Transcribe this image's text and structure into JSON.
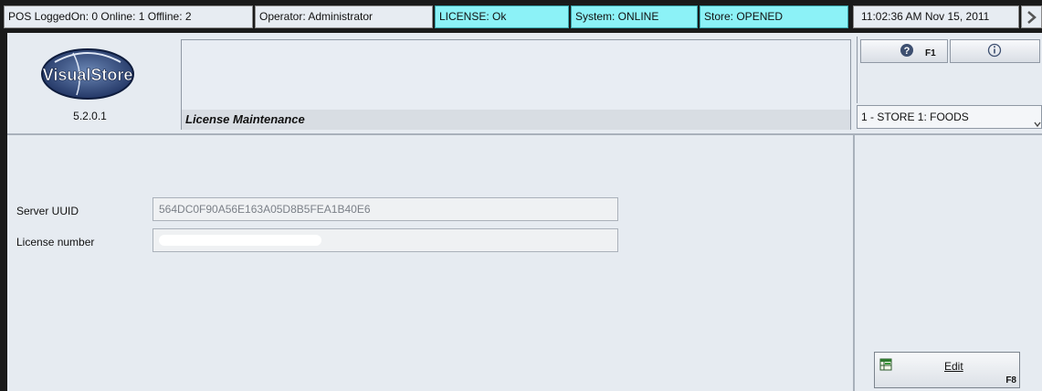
{
  "status": {
    "pos": "POS LoggedOn: 0  Online: 1  Offline: 2",
    "operator": "Operator:  Administrator",
    "license": "LICENSE: Ok",
    "system": "System: ONLINE",
    "store": "Store: OPENED",
    "datetime": "11:02:36 AM   Nov 15, 2011",
    "close_icon": "close-chevron-icon"
  },
  "app": {
    "logo_text": "VisualStore",
    "version": "5.2.0.1",
    "screen_title": "License Maintenance"
  },
  "toolbar": {
    "help_icon": "help-icon",
    "help_key": "F1",
    "info_icon": "info-icon"
  },
  "store_select": {
    "value": "1 - STORE 1: FOODS"
  },
  "form": {
    "server_uuid_label": "Server UUID",
    "server_uuid_value": "564DC0F90A56E163A05D8B5FEA1B40E6",
    "license_label": "License number",
    "license_value": ""
  },
  "actions": {
    "edit_label": "Edit",
    "edit_key": "F8",
    "edit_icon": "edit-record-icon"
  },
  "colors": {
    "status_cyan": "#8cf2f7",
    "background": "#e6ebf1",
    "dark_frame": "#1a1a1a"
  }
}
